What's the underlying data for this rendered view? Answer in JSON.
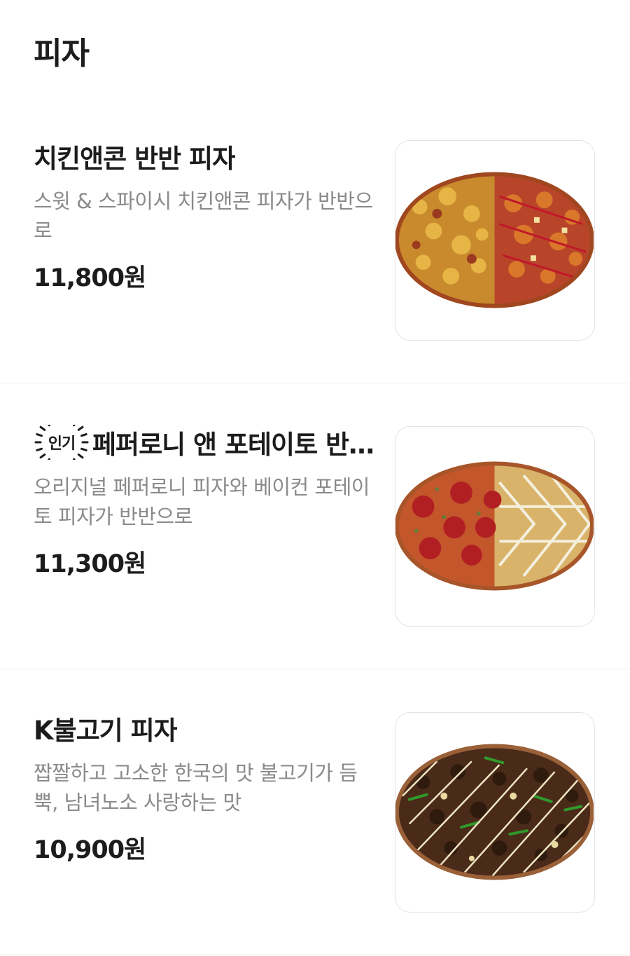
{
  "category": {
    "title": "피자"
  },
  "items": [
    {
      "name": "치킨앤콘 반반 피자",
      "description": "스윗 & 스파이시 치킨앤콘 피자가 반반으로",
      "price": "11,800원",
      "badge": null,
      "image": "half-half-chicken-corn-pizza"
    },
    {
      "name": "페퍼로니 앤 포테이토 반반 피자",
      "description": "오리지널 페퍼로니 피자와 베이컨 포테이토 피자가 반반으로",
      "price": "11,300원",
      "badge": "인기",
      "image": "half-half-pepperoni-potato-pizza"
    },
    {
      "name": "K불고기 피자",
      "description": "짭짤하고 고소한 한국의 맛 불고기가 듬뿍, 남녀노소 사랑하는 맛",
      "price": "10,900원",
      "badge": null,
      "image": "k-bulgogi-pizza"
    }
  ],
  "colors": {
    "text": "#1c1c1c",
    "secondary_text": "#8a8a8a",
    "divider": "#ececec",
    "thumb_border": "#e3e3e3"
  }
}
